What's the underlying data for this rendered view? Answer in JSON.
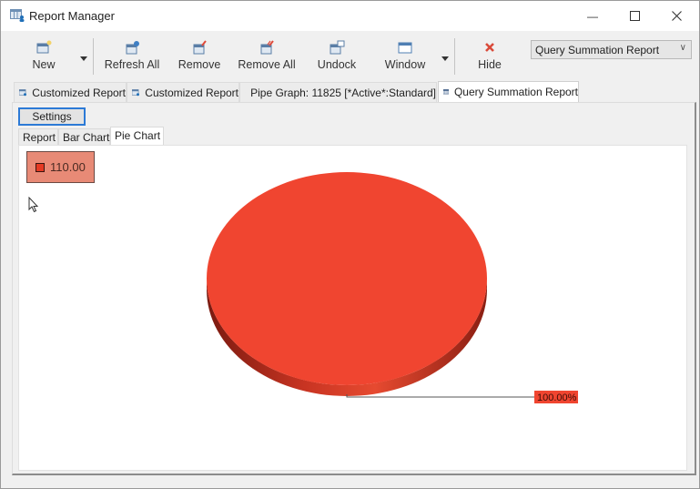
{
  "window": {
    "title": "Report Manager",
    "controls": {
      "minimize": "—",
      "maximize": "☐",
      "close": "✕"
    }
  },
  "toolbar": {
    "buttons": [
      {
        "id": "new",
        "label": "New",
        "icon": "new-report-icon",
        "has_dropdown": true
      },
      {
        "id": "refresh_all",
        "label": "Refresh All",
        "icon": "refresh-icon"
      },
      {
        "id": "remove",
        "label": "Remove",
        "icon": "remove-icon"
      },
      {
        "id": "remove_all",
        "label": "Remove All",
        "icon": "remove-all-icon"
      },
      {
        "id": "undock",
        "label": "Undock",
        "icon": "undock-icon"
      },
      {
        "id": "window",
        "label": "Window",
        "icon": "window-icon",
        "has_dropdown": true
      },
      {
        "id": "hide",
        "label": "Hide",
        "icon": "hide-x-icon"
      }
    ],
    "report_select": {
      "value": "Query Summation Report"
    }
  },
  "doc_tabs": [
    {
      "label": "Customized Report",
      "icon": "report-icon",
      "active": false
    },
    {
      "label": "Customized Report",
      "icon": "report-icon",
      "active": false
    },
    {
      "label": "Pipe Graph: 11825 [*Active*:Standard]",
      "icon": "graph-icon",
      "active": false
    },
    {
      "label": "Query Summation Report",
      "icon": "table-icon",
      "active": true
    }
  ],
  "panel": {
    "settings_label": "Settings",
    "sub_tabs": [
      {
        "label": "Report",
        "active": false
      },
      {
        "label": "Bar Chart",
        "active": false
      },
      {
        "label": "Pie Chart",
        "active": true
      }
    ]
  },
  "colors": {
    "slice": "#f04530",
    "slice_side": "#b02a1a",
    "legend_bg": "#e88a76",
    "label_bg": "#f04530",
    "accent_focus": "#2c7ad6",
    "hide_icon": "#d94a3a"
  },
  "chart_data": {
    "type": "pie",
    "style": "3d",
    "title": "",
    "legend": {
      "placement": "top-left",
      "entries": [
        {
          "label": "110.00",
          "color": "#e53a23"
        }
      ]
    },
    "slices": [
      {
        "label": "110.00",
        "value": 110.0,
        "percent": 100.0,
        "data_label": "100.00%",
        "color": "#f04530"
      }
    ]
  }
}
